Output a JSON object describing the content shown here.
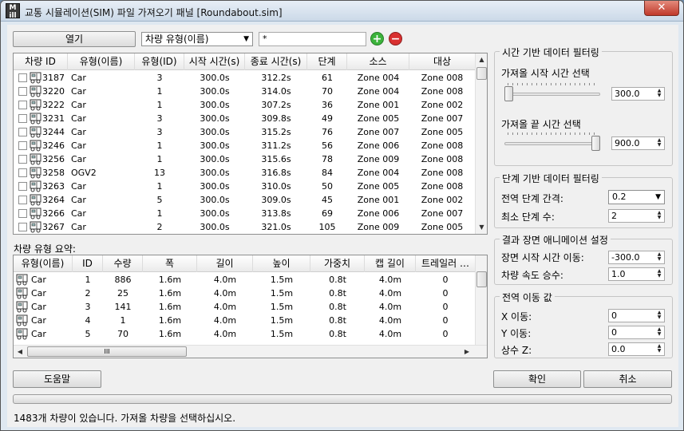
{
  "window": {
    "title": "교통 시뮬레이션(SIM) 파일 가져오기 패널 [Roundabout.sim]",
    "app_icon_text": "M",
    "app_icon_subtext": "ill",
    "close_glyph": "✕"
  },
  "toolbar": {
    "open_label": "열기",
    "filter_field_value": "차량 유형(이름)",
    "filter_text_value": "*",
    "add_glyph": "+",
    "remove_glyph": "−"
  },
  "vehicle_table": {
    "columns": [
      "차량 ID",
      "유형(이름)",
      "유형(ID)",
      "시작 시간(s)",
      "종료 시간(s)",
      "단계",
      "소스",
      "대상"
    ],
    "rows": [
      [
        "3187",
        "Car",
        "3",
        "300.0s",
        "312.2s",
        "61",
        "Zone 004",
        "Zone 008"
      ],
      [
        "3220",
        "Car",
        "1",
        "300.0s",
        "314.0s",
        "70",
        "Zone 004",
        "Zone 008"
      ],
      [
        "3222",
        "Car",
        "1",
        "300.0s",
        "307.2s",
        "36",
        "Zone 001",
        "Zone 002"
      ],
      [
        "3231",
        "Car",
        "3",
        "300.0s",
        "309.8s",
        "49",
        "Zone 005",
        "Zone 007"
      ],
      [
        "3244",
        "Car",
        "3",
        "300.0s",
        "315.2s",
        "76",
        "Zone 007",
        "Zone 005"
      ],
      [
        "3246",
        "Car",
        "1",
        "300.0s",
        "311.2s",
        "56",
        "Zone 006",
        "Zone 008"
      ],
      [
        "3256",
        "Car",
        "1",
        "300.0s",
        "315.6s",
        "78",
        "Zone 009",
        "Zone 008"
      ],
      [
        "3258",
        "OGV2",
        "13",
        "300.0s",
        "316.8s",
        "84",
        "Zone 004",
        "Zone 008"
      ],
      [
        "3263",
        "Car",
        "1",
        "300.0s",
        "310.0s",
        "50",
        "Zone 005",
        "Zone 008"
      ],
      [
        "3264",
        "Car",
        "5",
        "300.0s",
        "309.0s",
        "45",
        "Zone 001",
        "Zone 002"
      ],
      [
        "3266",
        "Car",
        "1",
        "300.0s",
        "313.8s",
        "69",
        "Zone 006",
        "Zone 007"
      ],
      [
        "3267",
        "Car",
        "2",
        "300.0s",
        "321.0s",
        "105",
        "Zone 009",
        "Zone 005"
      ]
    ]
  },
  "summary": {
    "label": "차량 유형 요약:",
    "columns": [
      "유형(이름)",
      "ID",
      "수량",
      "폭",
      "길이",
      "높이",
      "가중치",
      "캡 길이",
      "트레일러 …"
    ],
    "rows": [
      [
        "Car",
        "1",
        "886",
        "1.6m",
        "4.0m",
        "1.5m",
        "0.8t",
        "4.0m",
        "0"
      ],
      [
        "Car",
        "2",
        "25",
        "1.6m",
        "4.0m",
        "1.5m",
        "0.8t",
        "4.0m",
        "0"
      ],
      [
        "Car",
        "3",
        "141",
        "1.6m",
        "4.0m",
        "1.5m",
        "0.8t",
        "4.0m",
        "0"
      ],
      [
        "Car",
        "4",
        "1",
        "1.6m",
        "4.0m",
        "1.5m",
        "0.8t",
        "4.0m",
        "0"
      ],
      [
        "Car",
        "5",
        "70",
        "1.6m",
        "4.0m",
        "1.5m",
        "0.8t",
        "4.0m",
        "0"
      ]
    ],
    "hscroll_grip": "III"
  },
  "time_filter": {
    "title": "시간 기반 데이터 필터링",
    "start_label": "가져올 시작 시간 선택",
    "start_value": "300.0",
    "start_fraction": 0.0,
    "end_label": "가져올 끝 시간 선택",
    "end_value": "900.0",
    "end_fraction": 1.0
  },
  "step_filter": {
    "title": "단계 기반 데이터 필터링",
    "interval_label": "전역 단계 간격:",
    "interval_value": "0.2",
    "min_steps_label": "최소 단계 수:",
    "min_steps_value": "2"
  },
  "animation": {
    "title": "결과 장면 애니메이션 설정",
    "offset_label": "장면 시작 시간 이동:",
    "offset_value": "-300.0",
    "speed_label": "차량 속도 승수:",
    "speed_value": "1.0"
  },
  "translation": {
    "title": "전역 이동 값",
    "x_label": "X 이동:",
    "x_value": "0",
    "y_label": "Y 이동:",
    "y_value": "0",
    "z_label": "상수 Z:",
    "z_value": "0.0"
  },
  "buttons": {
    "help": "도움말",
    "ok": "확인",
    "cancel": "취소"
  },
  "status": {
    "text": "1483개 차량이 있습니다. 가져올 차량을 선택하십시오.",
    "progress": 0
  },
  "colors": {
    "add": "#3bb33b",
    "remove": "#d93030",
    "title_bar": "#cbd9e8"
  }
}
